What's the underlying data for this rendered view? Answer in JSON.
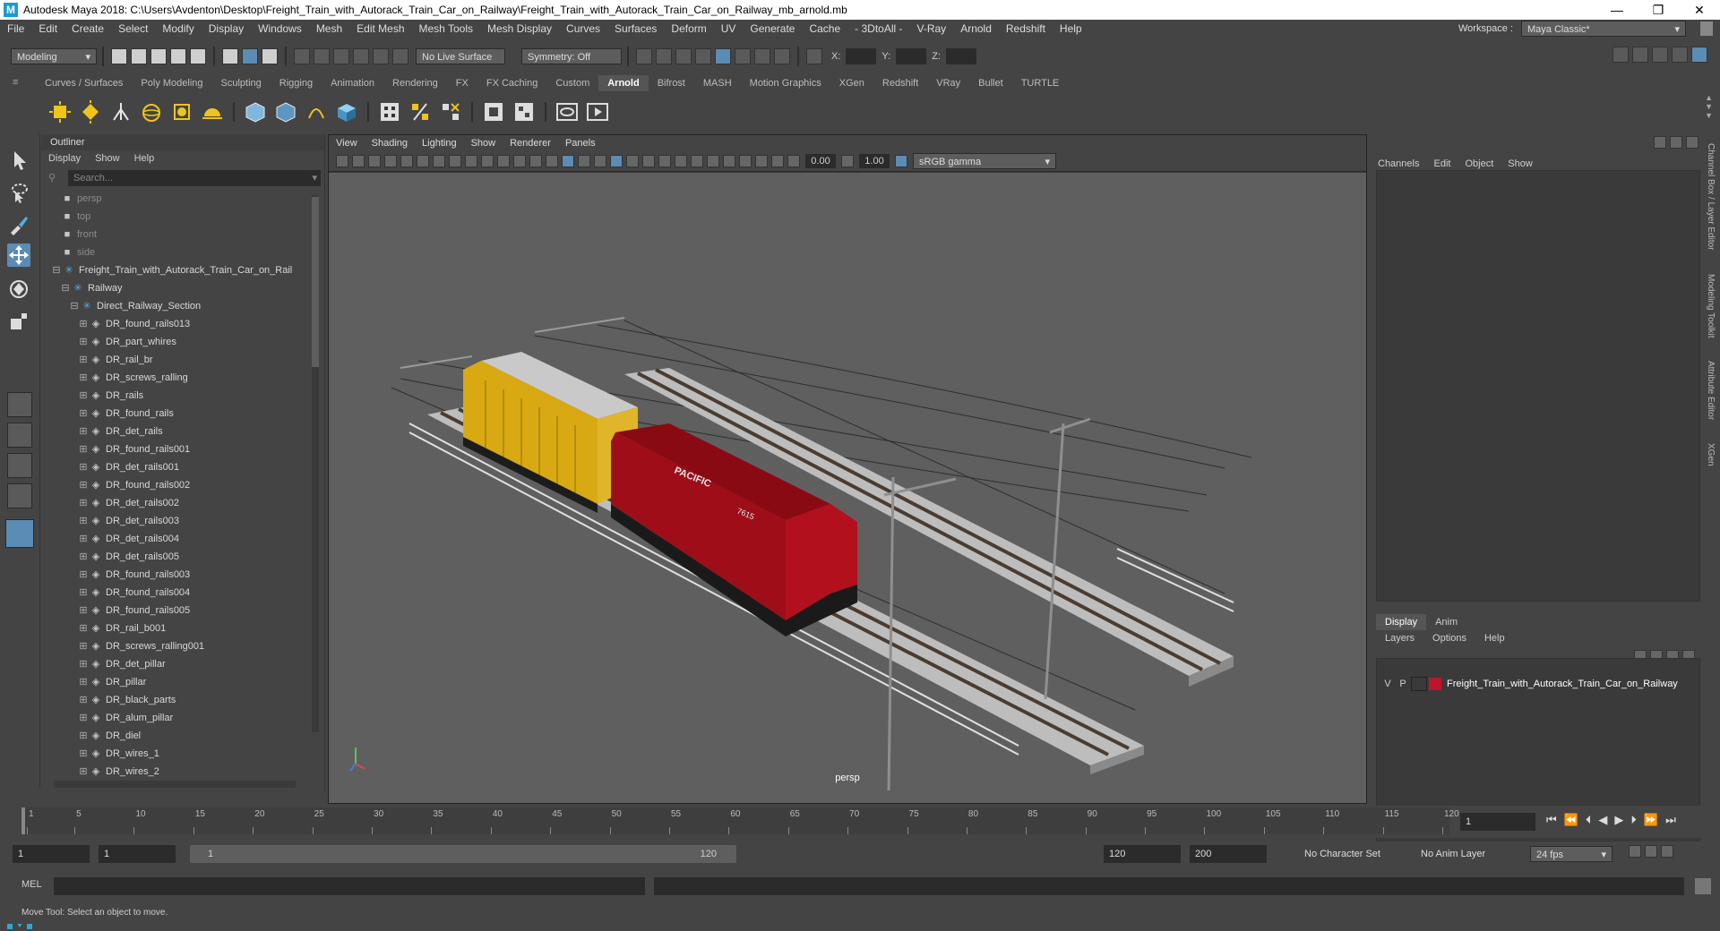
{
  "titlebar": {
    "title": "Autodesk Maya 2018: C:\\Users\\Avdenton\\Desktop\\Freight_Train_with_Autorack_Train_Car_on_Railway\\Freight_Train_with_Autorack_Train_Car_on_Railway_mb_arnold.mb",
    "minimize": "—",
    "restore": "❐",
    "close": "✕"
  },
  "menubar": {
    "items": [
      "File",
      "Edit",
      "Create",
      "Select",
      "Modify",
      "Display",
      "Windows",
      "Mesh",
      "Edit Mesh",
      "Mesh Tools",
      "Mesh Display",
      "Curves",
      "Surfaces",
      "Deform",
      "UV",
      "Generate",
      "Cache",
      "- 3DtoAll -",
      "V-Ray",
      "Arnold",
      "Redshift",
      "Help"
    ],
    "workspace_label": "Workspace :",
    "workspace_value": "Maya Classic*"
  },
  "statusline": {
    "mode": "Modeling",
    "live_surface": "No Live Surface",
    "symmetry": "Symmetry: Off",
    "x_label": "X:",
    "y_label": "Y:",
    "z_label": "Z:"
  },
  "shelf": {
    "tabs": [
      "Curves / Surfaces",
      "Poly Modeling",
      "Sculpting",
      "Rigging",
      "Animation",
      "Rendering",
      "FX",
      "FX Caching",
      "Custom",
      "Arnold",
      "Bifrost",
      "MASH",
      "Motion Graphics",
      "XGen",
      "Redshift",
      "VRay",
      "Bullet",
      "TURTLE"
    ],
    "active": "Arnold"
  },
  "outliner": {
    "title": "Outliner",
    "menu": [
      "Display",
      "Show",
      "Help"
    ],
    "search_placeholder": "Search...",
    "cameras": [
      "persp",
      "top",
      "front",
      "side"
    ],
    "root": "Freight_Train_with_Autorack_Train_Car_on_Rail",
    "railway": "Railway",
    "section": "Direct_Railway_Section",
    "items": [
      "DR_found_rails013",
      "DR_part_whires",
      "DR_rail_br",
      "DR_screws_ralling",
      "DR_rails",
      "DR_found_rails",
      "DR_det_rails",
      "DR_found_rails001",
      "DR_det_rails001",
      "DR_found_rails002",
      "DR_det_rails002",
      "DR_det_rails003",
      "DR_det_rails004",
      "DR_det_rails005",
      "DR_found_rails003",
      "DR_found_rails004",
      "DR_found_rails005",
      "DR_rail_b001",
      "DR_screws_ralling001",
      "DR_det_pillar",
      "DR_pillar",
      "DR_black_parts",
      "DR_alum_pillar",
      "DR_diel",
      "DR_wires_1",
      "DR_wires_2"
    ]
  },
  "viewport": {
    "menu": [
      "View",
      "Shading",
      "Lighting",
      "Show",
      "Renderer",
      "Panels"
    ],
    "exposure": "0.00",
    "gamma": "1.00",
    "color_space": "sRGB gamma",
    "camera_label": "persp",
    "locomotive_text": "PACIFIC",
    "locomotive_number": "7615"
  },
  "channelbox": {
    "menu": [
      "Channels",
      "Edit",
      "Object",
      "Show"
    ],
    "layer_tabs": [
      "Display",
      "Anim"
    ],
    "layer_menu": [
      "Layers",
      "Options",
      "Help"
    ],
    "layer_v": "V",
    "layer_p": "P",
    "layer_name": "Freight_Train_with_Autorack_Train_Car_on_Railway",
    "layer_color": "#c0142a",
    "side_tabs": [
      "Channel Box / Layer Editor",
      "Modeling Toolkit",
      "Attribute Editor",
      "XGen"
    ]
  },
  "timeslider": {
    "ticks": [
      "1",
      "5",
      "10",
      "15",
      "20",
      "25",
      "30",
      "35",
      "40",
      "45",
      "50",
      "55",
      "60",
      "65",
      "70",
      "75",
      "80",
      "85",
      "90",
      "95",
      "100",
      "105",
      "110",
      "115",
      "120"
    ],
    "current_frame": "1"
  },
  "rangeslider": {
    "start": "1",
    "start2": "1",
    "range_start": "1",
    "range_end": "120",
    "end": "120",
    "end2": "200",
    "character_set": "No Character Set",
    "anim_layer": "No Anim Layer",
    "fps": "24 fps"
  },
  "mel": {
    "label": "MEL"
  },
  "helpline": {
    "text": "Move Tool: Select an object to move."
  }
}
